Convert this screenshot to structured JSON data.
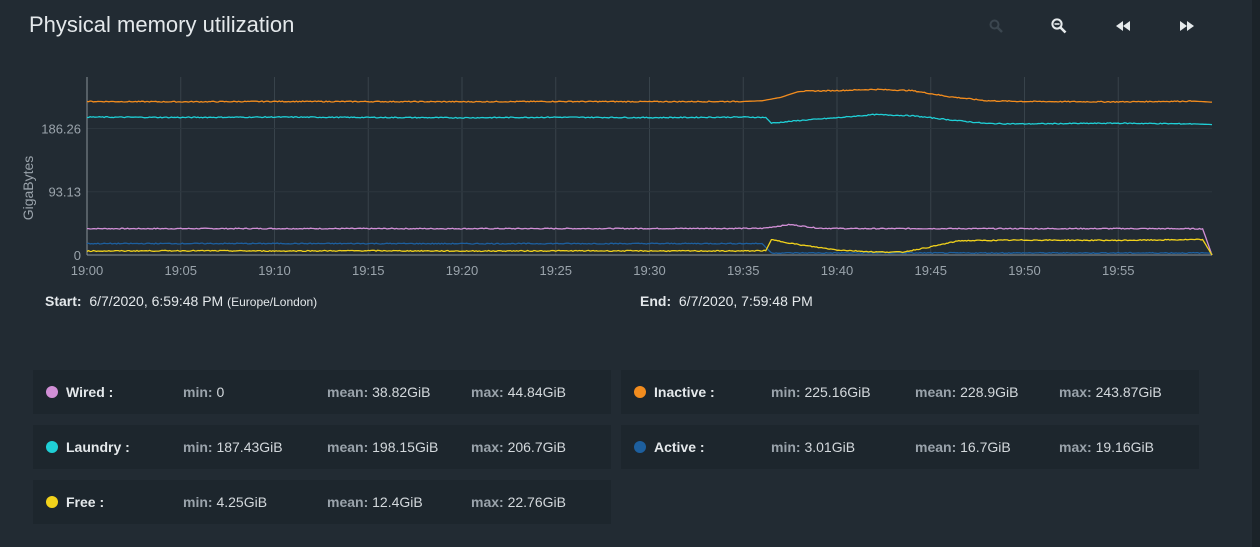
{
  "title": "Physical memory utilization",
  "toolbar": {
    "icons": [
      "zoom-in-icon",
      "zoom-out-icon",
      "rewind-icon",
      "fast-forward-icon"
    ]
  },
  "chart_data": {
    "type": "line",
    "ylabel": "GigaBytes",
    "xlabel": "",
    "y_ticks": [
      "0",
      "93.13",
      "186.26"
    ],
    "y_tick_values": [
      0,
      93.13,
      186.26
    ],
    "ylim": [
      0,
      262
    ],
    "x_ticks": [
      "19:00",
      "19:05",
      "19:10",
      "19:15",
      "19:20",
      "19:25",
      "19:30",
      "19:35",
      "19:40",
      "19:45",
      "19:50",
      "19:55"
    ],
    "x_tick_minutes": [
      0,
      5,
      10,
      15,
      20,
      25,
      30,
      35,
      40,
      45,
      50,
      55
    ],
    "xlim_minutes": [
      0,
      60
    ],
    "grid": true,
    "series": [
      {
        "name": "Wired",
        "color": "#d18fd6",
        "x": [
          0,
          10,
          20,
          30,
          36,
          37.5,
          39,
          41,
          45,
          50,
          55,
          59.5,
          60
        ],
        "y": [
          38.8,
          38.9,
          38.8,
          39.0,
          39.2,
          44.8,
          39.5,
          38.8,
          38.9,
          38.8,
          38.9,
          38.6,
          0
        ]
      },
      {
        "name": "Inactive",
        "color": "#f28c1e",
        "x": [
          0,
          5,
          10,
          15,
          20,
          25,
          30,
          35,
          36,
          37,
          38,
          40,
          42,
          44,
          46,
          48,
          50,
          55,
          59,
          60
        ],
        "y": [
          226,
          225.5,
          226,
          225.8,
          225.6,
          226,
          225.7,
          226,
          227,
          232,
          241,
          242,
          243.8,
          242,
          233,
          227,
          226,
          225.4,
          226.5,
          225
        ]
      },
      {
        "name": "Laundry",
        "color": "#1fcfd6",
        "x": [
          0,
          5,
          10,
          15,
          20,
          25,
          30,
          35,
          36.2,
          36.5,
          38,
          40,
          42,
          44,
          46,
          48,
          50,
          55,
          59,
          60
        ],
        "y": [
          203,
          202.5,
          203,
          202.5,
          202,
          202.8,
          202.2,
          203,
          202.5,
          194,
          198,
          202,
          206.7,
          205,
          199,
          193.5,
          193,
          194,
          193,
          192
        ]
      },
      {
        "name": "Active",
        "color": "#1d5f9e",
        "x": [
          0,
          10,
          20,
          30,
          36,
          36.5,
          40,
          45,
          50,
          55,
          60
        ],
        "y": [
          16.8,
          16.9,
          16.7,
          16.8,
          16.9,
          3.01,
          3.01,
          3.01,
          3.01,
          3.01,
          3.01
        ]
      },
      {
        "name": "Free",
        "color": "#f2d21b",
        "x": [
          0,
          5,
          10,
          15,
          20,
          25,
          30,
          35,
          36.2,
          36.5,
          38,
          40,
          42,
          43.5,
          45,
          46.5,
          50,
          55,
          59.5,
          60
        ],
        "y": [
          5.8,
          6.3,
          5.9,
          6.3,
          5.8,
          6.1,
          6.0,
          5.9,
          6.4,
          22.5,
          15,
          7.5,
          4.5,
          4.25,
          12,
          21,
          22,
          21.5,
          22.76,
          0
        ]
      }
    ]
  },
  "range": {
    "start_label": "Start:",
    "start_value": "6/7/2020, 6:59:48 PM",
    "start_tz": "(Europe/London)",
    "end_label": "End:",
    "end_value": "6/7/2020, 7:59:48 PM"
  },
  "legend": [
    {
      "name": "Wired :",
      "color": "#d18fd6",
      "min_label": "min:",
      "min": "0",
      "mean_label": "mean:",
      "mean": "38.82GiB",
      "max_label": "max:",
      "max": "44.84GiB"
    },
    {
      "name": "Inactive :",
      "color": "#f28c1e",
      "min_label": "min:",
      "min": "225.16GiB",
      "mean_label": "mean:",
      "mean": "228.9GiB",
      "max_label": "max:",
      "max": "243.87GiB"
    },
    {
      "name": "Laundry :",
      "color": "#1fcfd6",
      "min_label": "min:",
      "min": "187.43GiB",
      "mean_label": "mean:",
      "mean": "198.15GiB",
      "max_label": "max:",
      "max": "206.7GiB"
    },
    {
      "name": "Active :",
      "color": "#1d5f9e",
      "min_label": "min:",
      "min": "3.01GiB",
      "mean_label": "mean:",
      "mean": "16.7GiB",
      "max_label": "max:",
      "max": "19.16GiB"
    },
    {
      "name": "Free :",
      "color": "#f2d21b",
      "min_label": "min:",
      "min": "4.25GiB",
      "mean_label": "mean:",
      "mean": "12.4GiB",
      "max_label": "max:",
      "max": "22.76GiB"
    }
  ]
}
